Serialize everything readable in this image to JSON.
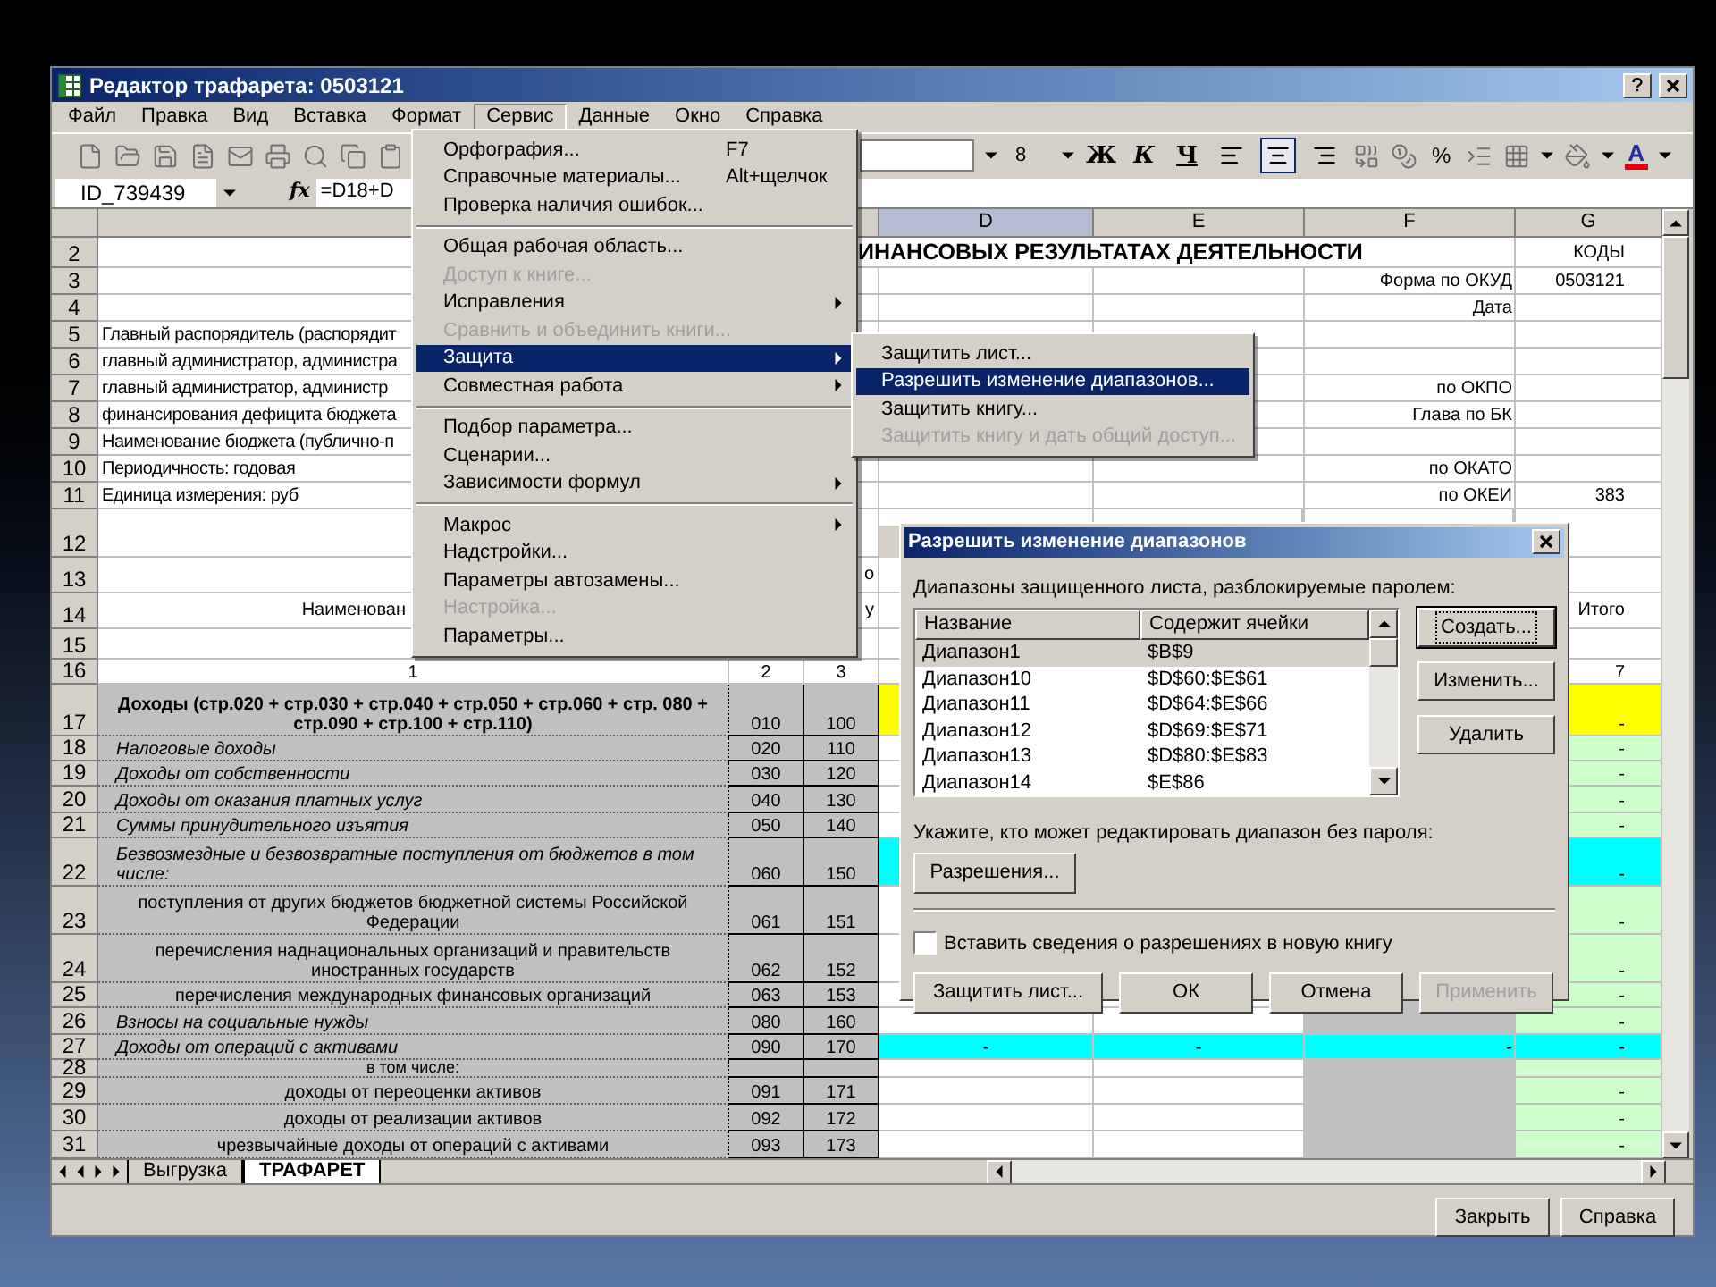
{
  "window": {
    "title": "Редактор трафарета: 0503121"
  },
  "menu_bar": [
    {
      "label": "Файл",
      "selected": false
    },
    {
      "label": "Правка",
      "selected": false
    },
    {
      "label": "Вид",
      "selected": false
    },
    {
      "label": "Вставка",
      "selected": false
    },
    {
      "label": "Формат",
      "selected": false
    },
    {
      "label": "Сервис",
      "selected": true
    },
    {
      "label": "Данные",
      "selected": false
    },
    {
      "label": "Окно",
      "selected": false
    },
    {
      "label": "Справка",
      "selected": false
    }
  ],
  "toolbar": {
    "font_size": "8",
    "format_buttons": [
      {
        "label": "Ж",
        "kind": "bold"
      },
      {
        "label": "К",
        "kind": "italic"
      },
      {
        "label": "Ч",
        "kind": "underline"
      }
    ],
    "alignments": [
      {
        "kind": "left",
        "selected": false
      },
      {
        "kind": "center",
        "selected": true
      },
      {
        "kind": "right",
        "selected": false
      }
    ],
    "percent": "%",
    "font_color": "A"
  },
  "formula_bar": {
    "name_box": "ID_739439",
    "function_label": "fx",
    "formula": "=D18+D"
  },
  "columns": [
    {
      "label": "D",
      "selected": true
    },
    {
      "label": "E",
      "selected": false
    },
    {
      "label": "F",
      "selected": false
    },
    {
      "label": "G",
      "selected": false
    }
  ],
  "rows": [
    {
      "number": "2",
      "kind": "heading",
      "cells": {
        "D": "ИНАНСОВЫХ РЕЗУЛЬТАТАХ ДЕЯТЕЛЬНОСТИ",
        "G": "КОДЫ"
      }
    },
    {
      "number": "3",
      "kind": "heading",
      "cells": {
        "F": "Форма по ОКУД",
        "G": "0503121"
      }
    },
    {
      "number": "4",
      "kind": "heading",
      "cells": {
        "F": "Дата"
      }
    },
    {
      "number": "5",
      "kind": "heading",
      "cells": {
        "A": "Главный распорядитель (распорядит"
      }
    },
    {
      "number": "6",
      "kind": "heading",
      "cells": {
        "A": "главный администратор, администра"
      }
    },
    {
      "number": "7",
      "kind": "heading",
      "cells": {
        "A": "главный администратор, администр",
        "F": "по ОКПО"
      }
    },
    {
      "number": "8",
      "kind": "heading",
      "cells": {
        "A": "финансирования дефицита бюджета",
        "F": "Глава по БК"
      }
    },
    {
      "number": "9",
      "kind": "heading",
      "cells": {
        "A": "Наименование бюджета (публично-п"
      }
    },
    {
      "number": "10",
      "kind": "heading",
      "cells": {
        "A": "Периодичность: годовая",
        "F": "по ОКАТО"
      }
    },
    {
      "number": "11",
      "kind": "heading",
      "cells": {
        "A": "Единица измерения: руб",
        "F": "по ОКЕИ",
        "G": "383"
      }
    },
    {
      "number": "12",
      "kind": "heading",
      "cells": {}
    },
    {
      "number": "13",
      "kind": "heading",
      "cells": {
        "C": "о"
      }
    },
    {
      "number": "14",
      "kind": "caption",
      "cells": {
        "A": "Наименован",
        "C": "у",
        "G": "Итого"
      }
    },
    {
      "number": "15",
      "kind": "heading",
      "cells": {}
    },
    {
      "number": "16",
      "kind": "numbering",
      "cells": {
        "A": "1",
        "B": "2",
        "C": "3",
        "G": "7"
      }
    },
    {
      "number": "17",
      "kind": "total",
      "cells": {
        "A": "Доходы (стр.020 + стр.030 + стр.040 + стр.050 + стр.060 + стр. 080 + стр.090 + стр.100 + стр.110)",
        "B": "010",
        "C": "100",
        "G": "-"
      }
    },
    {
      "number": "18",
      "kind": "line",
      "cells": {
        "A": "Налоговые доходы",
        "B": "020",
        "C": "110",
        "G": "-"
      }
    },
    {
      "number": "19",
      "kind": "line",
      "cells": {
        "A": "Доходы от собственности",
        "B": "030",
        "C": "120",
        "G": "-"
      }
    },
    {
      "number": "20",
      "kind": "line",
      "cells": {
        "A": "Доходы от оказания платных услуг",
        "B": "040",
        "C": "130",
        "G": "-"
      }
    },
    {
      "number": "21",
      "kind": "line",
      "cells": {
        "A": "Суммы принудительного изъятия",
        "B": "050",
        "C": "140",
        "G": "-"
      }
    },
    {
      "number": "22",
      "kind": "group",
      "cells": {
        "A": "Безвозмездные и безвозвратные поступления от бюджетов в том числе:",
        "B": "060",
        "C": "150",
        "G": "-"
      }
    },
    {
      "number": "23",
      "kind": "detail",
      "cells": {
        "A": "поступления от других бюджетов бюджетной системы Российской Федерации",
        "B": "061",
        "C": "151",
        "G": "-"
      }
    },
    {
      "number": "24",
      "kind": "detail",
      "cells": {
        "A": "перечисления наднациональных организаций и правительств иностранных государств",
        "B": "062",
        "C": "152",
        "G": "-"
      }
    },
    {
      "number": "25",
      "kind": "detail",
      "cells": {
        "A": "перечисления международных финансовых организаций",
        "B": "063",
        "C": "153",
        "G": "-"
      }
    },
    {
      "number": "26",
      "kind": "line",
      "cells": {
        "A": "Взносы на социальные нужды",
        "B": "080",
        "C": "160",
        "G": "-"
      }
    },
    {
      "number": "27",
      "kind": "group",
      "cells": {
        "A": "Доходы от операций с активами",
        "B": "090",
        "C": "170",
        "D": "-",
        "E": "-",
        "F": "-",
        "G": "-"
      }
    },
    {
      "number": "28",
      "kind": "detail",
      "cells": {
        "A": "в том числе:"
      }
    },
    {
      "number": "29",
      "kind": "detail",
      "cells": {
        "A": "доходы от переоценки активов",
        "B": "091",
        "C": "171",
        "G": "-"
      }
    },
    {
      "number": "30",
      "kind": "detail",
      "cells": {
        "A": "доходы от реализации активов",
        "B": "092",
        "C": "172",
        "G": "-"
      }
    },
    {
      "number": "31",
      "kind": "detail",
      "cells": {
        "A": "чрезвычайные доходы от операций с активами",
        "B": "093",
        "C": "173",
        "G": "-"
      }
    }
  ],
  "sheet_tabs": [
    {
      "label": "Выгрузка",
      "selected": false
    },
    {
      "label": "ТРАФАРЕТ",
      "selected": true
    }
  ],
  "footer_buttons": [
    "Закрыть",
    "Справка"
  ],
  "menu": {
    "items": [
      {
        "kind": "item",
        "label": "Орфография...",
        "shortcut": "F7",
        "disabled": false,
        "submenu": false,
        "selected": false
      },
      {
        "kind": "item",
        "label": "Справочные материалы...",
        "shortcut": "Alt+щелчок",
        "disabled": false,
        "submenu": false,
        "selected": false
      },
      {
        "kind": "item",
        "label": "Проверка наличия ошибок...",
        "disabled": false,
        "submenu": false,
        "selected": false
      },
      {
        "kind": "separator"
      },
      {
        "kind": "item",
        "label": "Общая рабочая область...",
        "disabled": false,
        "submenu": false,
        "selected": false
      },
      {
        "kind": "item",
        "label": "Доступ к книге...",
        "disabled": true,
        "submenu": false,
        "selected": false
      },
      {
        "kind": "item",
        "label": "Исправления",
        "disabled": false,
        "submenu": true,
        "selected": false
      },
      {
        "kind": "item",
        "label": "Сравнить и объединить книги...",
        "disabled": true,
        "submenu": false,
        "selected": false
      },
      {
        "kind": "item",
        "label": "Защита",
        "disabled": false,
        "submenu": true,
        "selected": true
      },
      {
        "kind": "item",
        "label": "Совместная работа",
        "disabled": false,
        "submenu": true,
        "selected": false
      },
      {
        "kind": "separator"
      },
      {
        "kind": "item",
        "label": "Подбор параметра...",
        "disabled": false,
        "submenu": false,
        "selected": false
      },
      {
        "kind": "item",
        "label": "Сценарии...",
        "disabled": false,
        "submenu": false,
        "selected": false
      },
      {
        "kind": "item",
        "label": "Зависимости формул",
        "disabled": false,
        "submenu": true,
        "selected": false
      },
      {
        "kind": "separator"
      },
      {
        "kind": "item",
        "label": "Макрос",
        "disabled": false,
        "submenu": true,
        "selected": false
      },
      {
        "kind": "item",
        "label": "Надстройки...",
        "disabled": false,
        "submenu": false,
        "selected": false
      },
      {
        "kind": "item",
        "label": "Параметры автозамены...",
        "disabled": false,
        "submenu": false,
        "selected": false
      },
      {
        "kind": "item",
        "label": "Настройка...",
        "disabled": true,
        "submenu": false,
        "selected": false
      },
      {
        "kind": "item",
        "label": "Параметры...",
        "disabled": false,
        "submenu": false,
        "selected": false
      }
    ]
  },
  "submenu": {
    "items": [
      {
        "label": "Защитить лист...",
        "disabled": false,
        "selected": false
      },
      {
        "label": "Разрешить изменение диапазонов...",
        "disabled": false,
        "selected": true
      },
      {
        "label": "Защитить книгу...",
        "disabled": false,
        "selected": false
      },
      {
        "label": "Защитить книгу и дать общий доступ...",
        "disabled": true,
        "selected": false
      }
    ]
  },
  "dialog": {
    "title": "Разрешить изменение диапазонов",
    "ranges_label": "Диапазоны защищенного листа, разблокируемые паролем:",
    "list_columns": [
      "Название",
      "Содержит ячейки"
    ],
    "ranges": [
      {
        "name": "Диапазон1",
        "cells": "$B$9",
        "selected": true
      },
      {
        "name": "Диапазон10",
        "cells": "$D$60:$E$61",
        "selected": false
      },
      {
        "name": "Диапазон11",
        "cells": "$D$64:$E$66",
        "selected": false
      },
      {
        "name": "Диапазон12",
        "cells": "$D$69:$E$71",
        "selected": false
      },
      {
        "name": "Диапазон13",
        "cells": "$D$80:$E$83",
        "selected": false
      },
      {
        "name": "Диапазон14",
        "cells": "$E$86",
        "selected": false
      }
    ],
    "side_buttons": [
      {
        "label": "Создать...",
        "default": true
      },
      {
        "label": "Изменить...",
        "default": false
      },
      {
        "label": "Удалить",
        "default": false
      }
    ],
    "permission_label": "Укажите, кто может редактировать диапазон без пароля:",
    "permission_button": "Разрешения...",
    "checkbox": {
      "label": "Вставить сведения о разрешениях в новую книгу",
      "checked": false
    },
    "bottom_buttons": [
      {
        "label": "Защитить лист...",
        "disabled": false
      },
      {
        "label": "ОК",
        "disabled": false
      },
      {
        "label": "Отмена",
        "disabled": false
      },
      {
        "label": "Применить",
        "disabled": true
      }
    ]
  }
}
